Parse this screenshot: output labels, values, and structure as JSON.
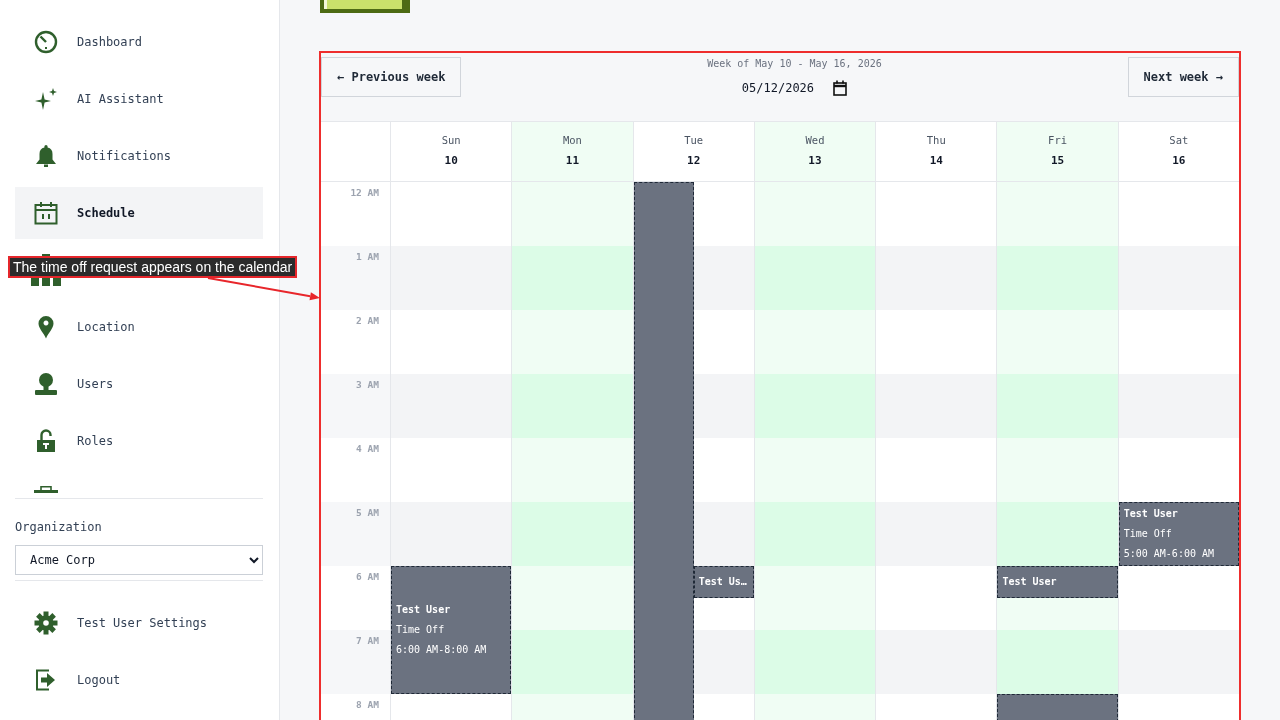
{
  "sidebar": {
    "nav_items": [
      {
        "label": "Dashboard",
        "selected": false
      },
      {
        "label": "AI Assistant",
        "selected": false
      },
      {
        "label": "Notifications",
        "selected": false
      },
      {
        "label": "Schedule",
        "selected": true
      },
      {
        "selected": false
      },
      {
        "label": "Location",
        "selected": false
      },
      {
        "label": "Users",
        "selected": false
      },
      {
        "label": "Roles",
        "selected": false
      },
      {
        "selected": false
      }
    ],
    "organization": {
      "label": "Organization",
      "value": "Acme Corp"
    },
    "account_items": [
      {
        "label": "Test User Settings"
      },
      {
        "label": "Logout"
      }
    ]
  },
  "calendar": {
    "previous_button": "← Previous week",
    "week_label": "Week of May 10 - May 16, 2026",
    "date_value": "05/12/2026",
    "next_button": "Next week →",
    "hours": [
      "12 AM",
      "1 AM",
      "2 AM",
      "3 AM",
      "4 AM",
      "5 AM",
      "6 AM",
      "7 AM",
      "8 AM"
    ],
    "days": [
      {
        "name": "Sun",
        "date": "10",
        "highlighted": false,
        "events": [
          {
            "kind": "time_off",
            "title": "Test User",
            "type": "Time Off",
            "time": "6:00 AM-8:00 AM"
          }
        ]
      },
      {
        "name": "Mon",
        "date": "11",
        "highlighted": true
      },
      {
        "name": "Tue",
        "date": "12",
        "highlighted": false,
        "events": [
          {
            "kind": "time_off"
          },
          {
            "kind": "time_off",
            "title": "Test Us…"
          }
        ]
      },
      {
        "name": "Wed",
        "date": "13",
        "highlighted": true
      },
      {
        "name": "Thu",
        "date": "14",
        "highlighted": false
      },
      {
        "name": "Fri",
        "date": "15",
        "highlighted": true,
        "events": [
          {
            "kind": "time_off",
            "title": "Test User"
          },
          {
            "kind": "time_off"
          }
        ]
      },
      {
        "name": "Sat",
        "date": "16",
        "highlighted": false,
        "events": [
          {
            "kind": "time_off",
            "title": "Test User",
            "type": "Time Off",
            "time": "5:00 AM-6:00 AM"
          }
        ]
      }
    ]
  },
  "annotation": {
    "text": "The time off request appears on the calendar"
  }
}
